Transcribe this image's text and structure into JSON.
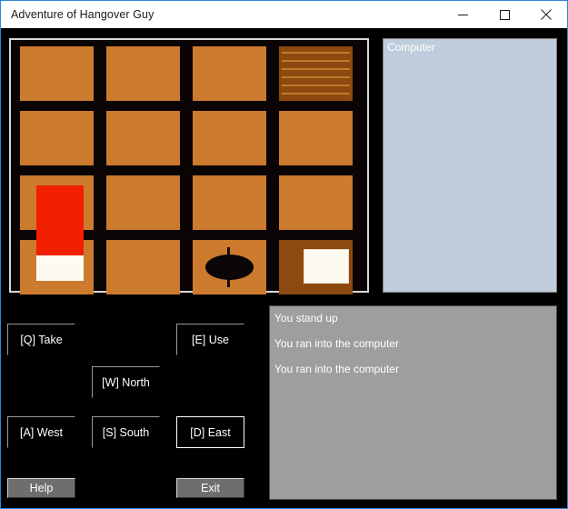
{
  "window": {
    "title": "Adventure of Hangover Guy",
    "controls": [
      {
        "name": "minimize",
        "label": "—"
      },
      {
        "name": "maximize",
        "label": "☐"
      },
      {
        "name": "close",
        "label": "✕"
      }
    ]
  },
  "map": {
    "columns": 4,
    "rows": 4,
    "floor_color": "#cc7a2e",
    "wall_color": "#0a0405",
    "tiles": [
      {
        "row": 0,
        "col": 0,
        "kind": "floor"
      },
      {
        "row": 0,
        "col": 1,
        "kind": "floor"
      },
      {
        "row": 0,
        "col": 2,
        "kind": "floor"
      },
      {
        "row": 0,
        "col": 3,
        "kind": "striped-wood"
      },
      {
        "row": 1,
        "col": 0,
        "kind": "floor"
      },
      {
        "row": 1,
        "col": 1,
        "kind": "floor"
      },
      {
        "row": 1,
        "col": 2,
        "kind": "floor"
      },
      {
        "row": 1,
        "col": 3,
        "kind": "floor"
      },
      {
        "row": 2,
        "col": 0,
        "kind": "floor"
      },
      {
        "row": 2,
        "col": 1,
        "kind": "floor"
      },
      {
        "row": 2,
        "col": 2,
        "kind": "floor"
      },
      {
        "row": 2,
        "col": 3,
        "kind": "floor"
      },
      {
        "row": 3,
        "col": 0,
        "kind": "floor"
      },
      {
        "row": 3,
        "col": 1,
        "kind": "floor"
      },
      {
        "row": 3,
        "col": 2,
        "kind": "floor"
      },
      {
        "row": 3,
        "col": 3,
        "kind": "dark-wood"
      }
    ],
    "objects": [
      {
        "name": "bed",
        "color": "#f22000",
        "pillow_color": "#fdfbef"
      },
      {
        "name": "table",
        "color": "#0b0708"
      },
      {
        "name": "computer-desk",
        "screen_color": "#fdfbf0",
        "desk_color": "#8c4a10"
      }
    ]
  },
  "object_list": {
    "items": [
      {
        "label": "Computer"
      }
    ]
  },
  "message_log": {
    "lines": [
      {
        "text": "You stand up"
      },
      {
        "text": "You ran into the computer"
      },
      {
        "text": "You ran into the computer"
      }
    ]
  },
  "actions": {
    "take": {
      "label": "[Q] Take",
      "focused": false
    },
    "use": {
      "label": "[E] Use",
      "focused": false
    },
    "north": {
      "label": "[W] North",
      "focused": false
    },
    "west": {
      "label": "[A] West",
      "focused": false
    },
    "south": {
      "label": "[S] South",
      "focused": false
    },
    "east": {
      "label": "[D] East",
      "focused": true
    }
  },
  "footer": {
    "help": {
      "label": "Help"
    },
    "exit": {
      "label": "Exit"
    }
  }
}
